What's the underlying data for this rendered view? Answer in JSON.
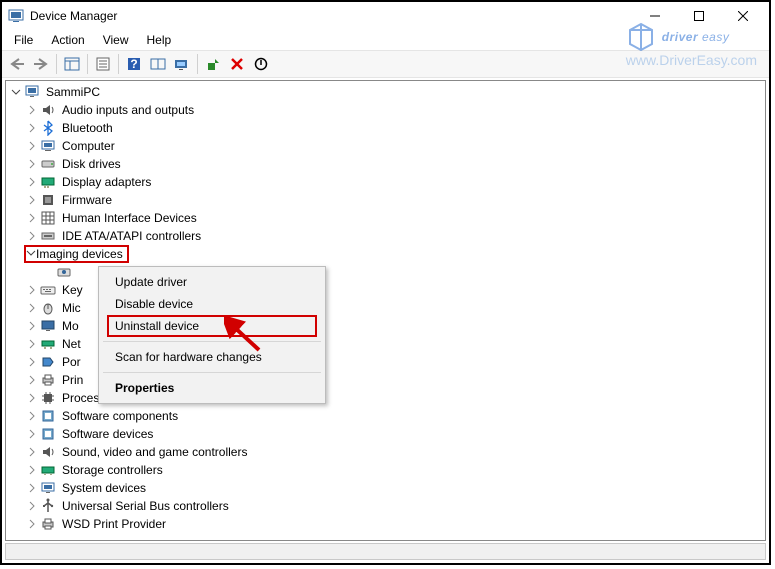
{
  "window": {
    "title": "Device Manager"
  },
  "menubar": {
    "file": "File",
    "action": "Action",
    "view": "View",
    "help": "Help"
  },
  "tree": {
    "root": "SammiPC",
    "nodes": {
      "audio": "Audio inputs and outputs",
      "bluetooth": "Bluetooth",
      "computer": "Computer",
      "disk": "Disk drives",
      "display": "Display adapters",
      "firmware": "Firmware",
      "hid": "Human Interface Devices",
      "ide": "IDE ATA/ATAPI controllers",
      "imaging": "Imaging devices",
      "keyboard_trunc": "Key",
      "mice_trunc": "Mic",
      "monitors_trunc": "Mo",
      "network_trunc": "Net",
      "ports_trunc": "Por",
      "printq_trunc": "Prin",
      "processors": "Processors",
      "swcomp": "Software components",
      "swdev": "Software devices",
      "sound": "Sound, video and game controllers",
      "storage": "Storage controllers",
      "system": "System devices",
      "usb": "Universal Serial Bus controllers",
      "wsd": "WSD Print Provider"
    }
  },
  "context_menu": {
    "update": "Update driver",
    "disable": "Disable device",
    "uninstall": "Uninstall device",
    "scan": "Scan for hardware changes",
    "properties": "Properties"
  },
  "watermark": {
    "brand_a": "driver",
    "brand_b": "easy",
    "url": "www.DriverEasy.com"
  }
}
